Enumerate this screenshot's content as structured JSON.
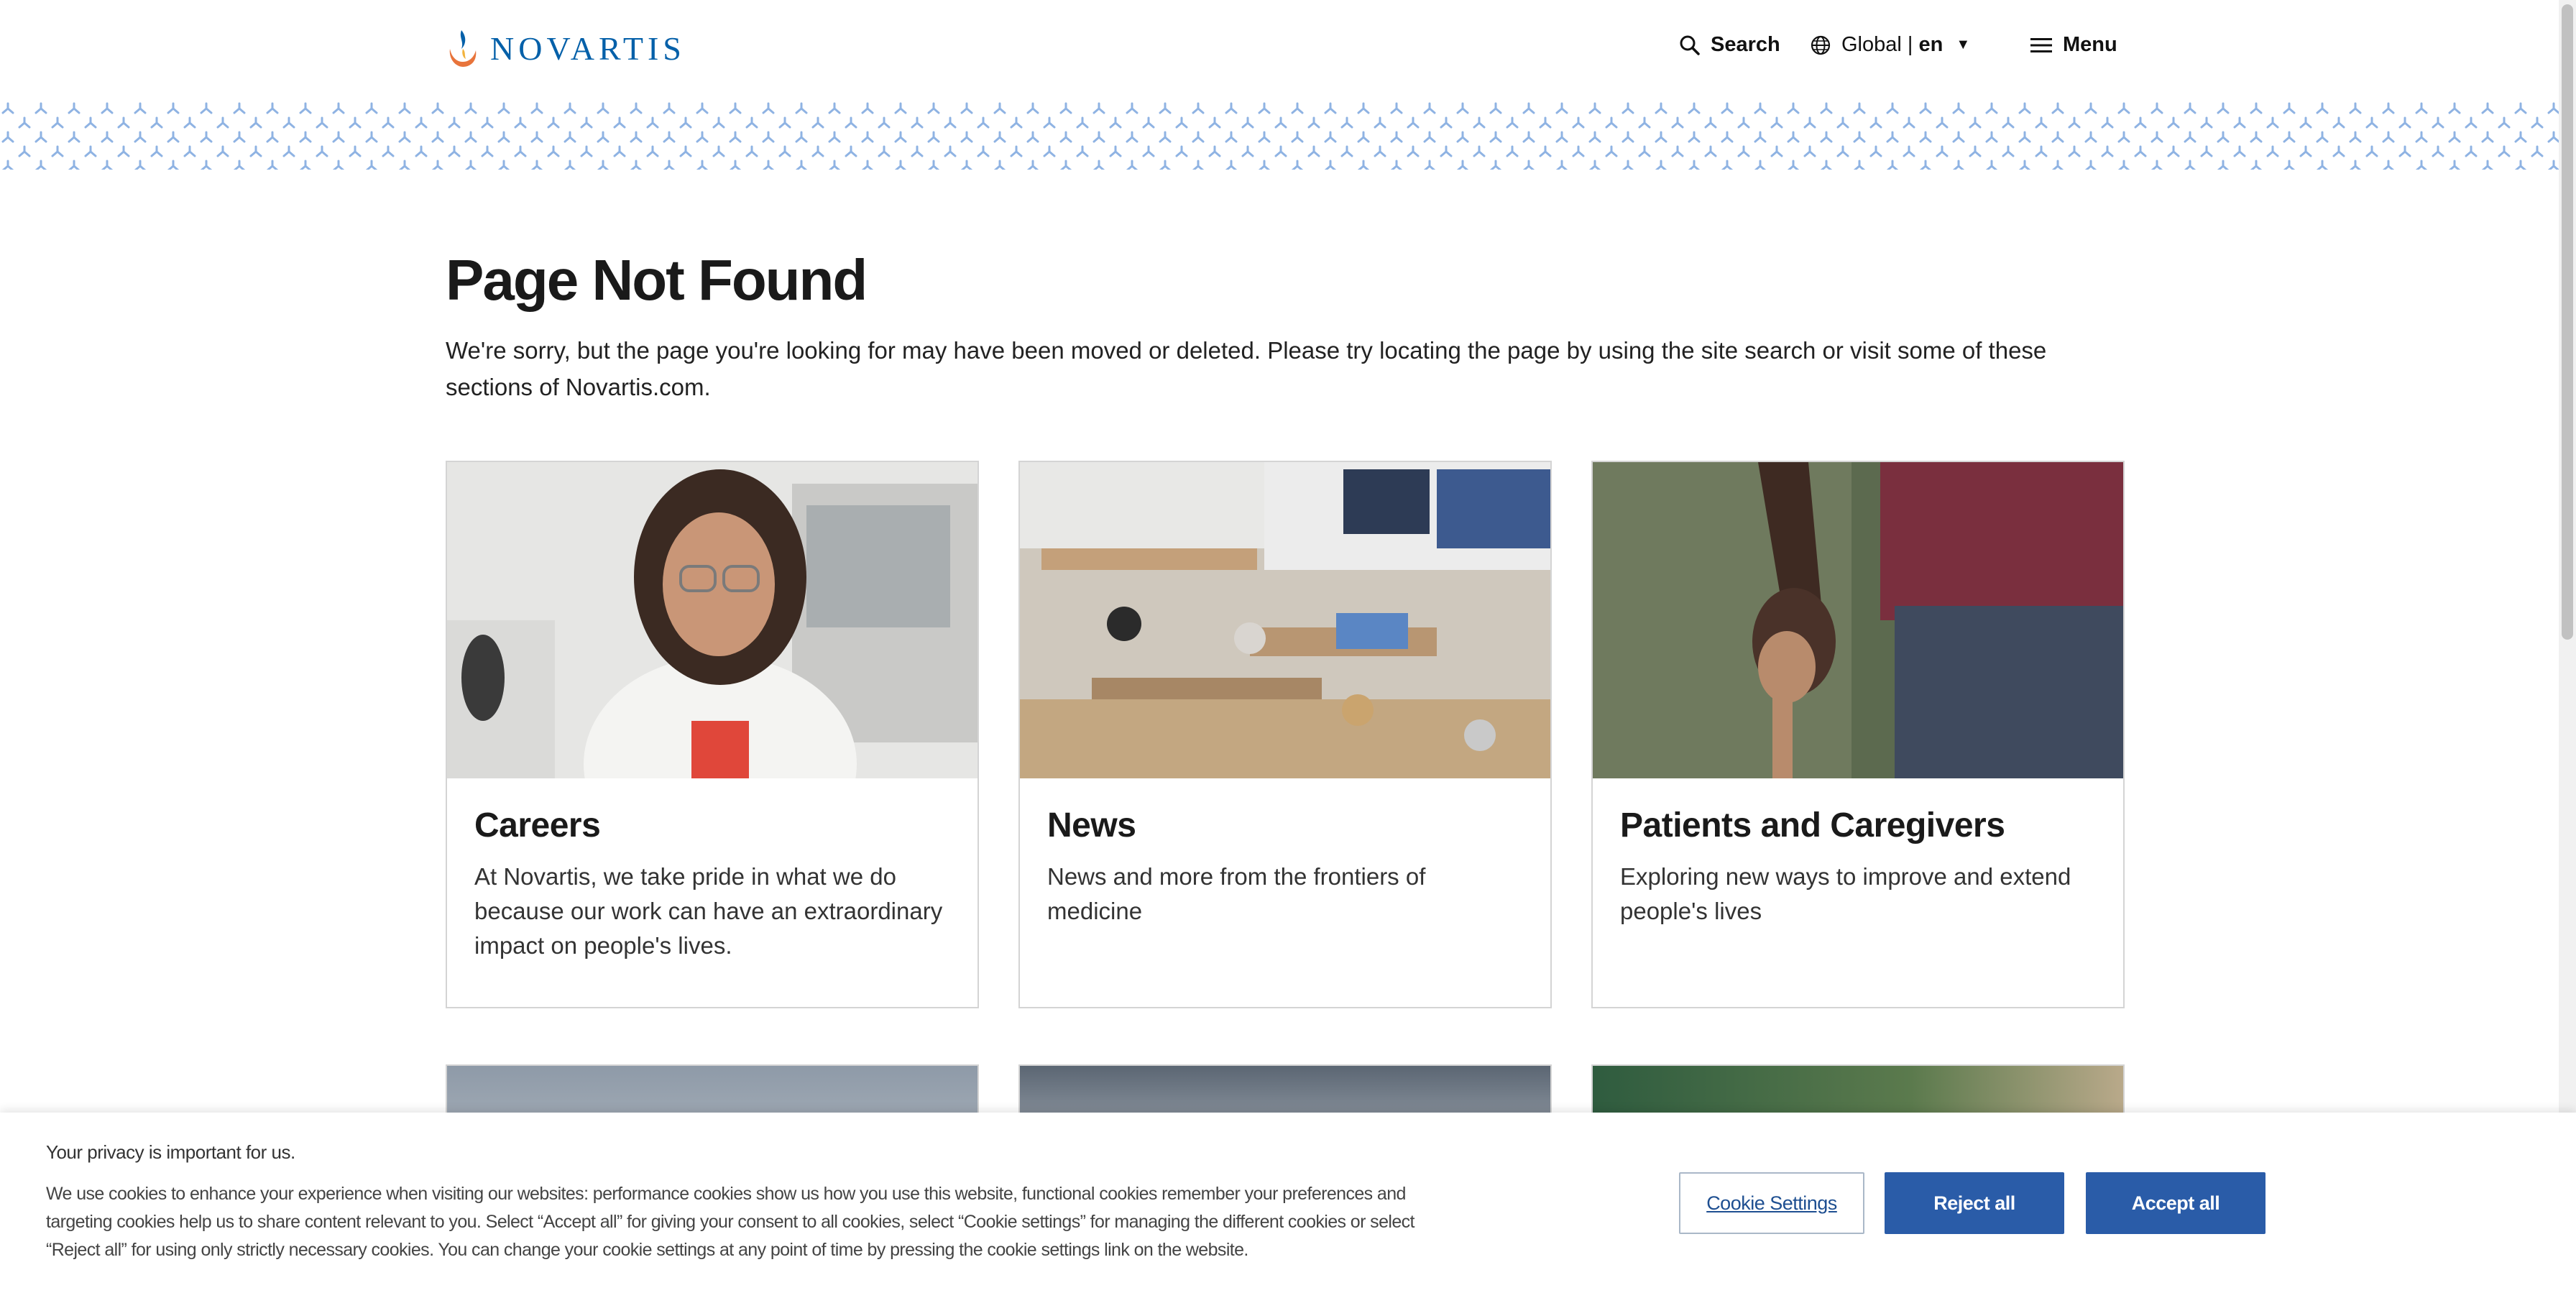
{
  "header": {
    "logo_text": "NOVARTIS",
    "search_label": "Search",
    "region_label": "Global | ",
    "language": "en",
    "menu_label": "Menu"
  },
  "main": {
    "title": "Page Not Found",
    "intro": "We're sorry, but the page you're looking for may have been moved or deleted. Please try locating the page by using the site search or visit some of these sections of Novartis.com."
  },
  "cards": [
    {
      "title": "Careers",
      "description": "At Novartis, we take pride in what we do because our work can have an extraordinary impact on people's lives."
    },
    {
      "title": "News",
      "description": "News and more from the frontiers of medicine"
    },
    {
      "title": "Patients and Caregivers",
      "description": "Exploring new ways to improve and extend people's lives"
    }
  ],
  "cookie_banner": {
    "title": "Your privacy is important for us.",
    "text": "We use cookies to enhance your experience when visiting our websites: performance cookies show us how you use this website, functional cookies remember your preferences and targeting cookies help us to share content relevant to you. Select “Accept all” for giving your consent to all cookies, select “Cookie settings” for managing the different cookies or select “Reject all” for using only strictly necessary cookies. You can change your cookie settings at any point of time by pressing the cookie settings link on the website.",
    "settings_label": "Cookie Settings",
    "reject_label": "Reject all",
    "accept_label": "Accept all"
  },
  "colors": {
    "brand_blue": "#0460a9",
    "button_blue": "#2a5ca8",
    "pattern_blue": "#8fb3e3"
  },
  "icons": [
    "novartis-flame-logo",
    "search-icon",
    "globe-icon",
    "caret-down-icon",
    "hamburger-menu-icon"
  ]
}
